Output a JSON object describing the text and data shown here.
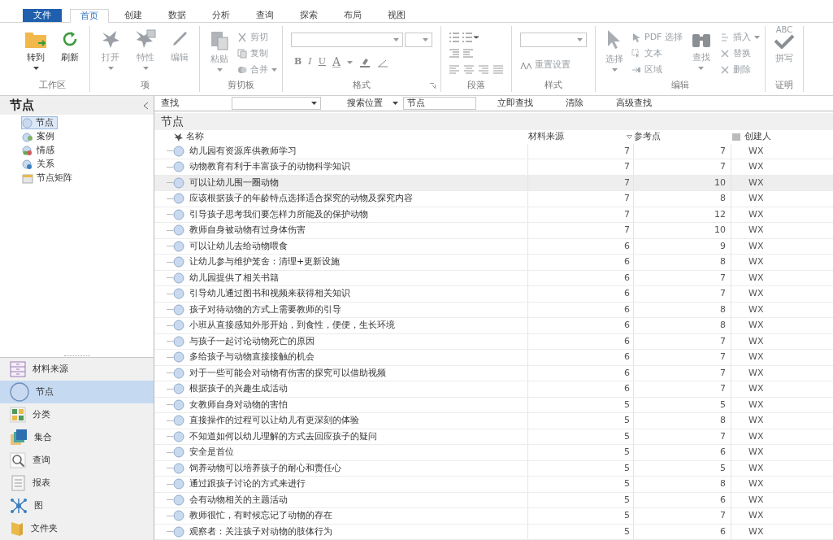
{
  "ribbon_tabs": [
    {
      "kind": "file",
      "label": "文件"
    },
    {
      "kind": "tab",
      "label": "首页",
      "selected": true
    },
    {
      "kind": "tab",
      "label": "创建",
      "selected": false
    },
    {
      "kind": "tab",
      "label": "数据",
      "selected": false
    },
    {
      "kind": "tab",
      "label": "分析",
      "selected": false
    },
    {
      "kind": "tab",
      "label": "查询",
      "selected": false
    },
    {
      "kind": "tab",
      "label": "探索",
      "selected": false
    },
    {
      "kind": "tab",
      "label": "布局",
      "selected": false
    },
    {
      "kind": "tab",
      "label": "视图",
      "selected": false
    }
  ],
  "ribbon_groups": [
    {
      "kind": "buttons",
      "label": "工作区",
      "items": [
        {
          "kind": "large",
          "label": "转到",
          "dropdown": true,
          "disabled": false
        },
        {
          "kind": "large",
          "label": "刷新",
          "dropdown": false,
          "disabled": false
        }
      ]
    },
    {
      "kind": "buttons",
      "label": "项",
      "items": [
        {
          "kind": "large",
          "label": "打开",
          "dropdown": true,
          "disabled": true
        },
        {
          "kind": "large",
          "label": "特性",
          "dropdown": true,
          "disabled": true
        },
        {
          "kind": "large",
          "label": "编辑",
          "dropdown": false,
          "disabled": true
        }
      ]
    },
    {
      "kind": "buttons",
      "label": "剪切板",
      "items": [
        {
          "kind": "large",
          "label": "粘贴",
          "dropdown": true,
          "disabled": true
        },
        {
          "kind": "small",
          "label": "剪切",
          "dropdown": false,
          "disabled": true
        },
        {
          "kind": "small",
          "label": "复制",
          "dropdown": false,
          "disabled": true
        },
        {
          "kind": "small",
          "label": "合并",
          "dropdown": true,
          "disabled": true
        }
      ]
    },
    {
      "kind": "format",
      "label": "格式",
      "launcher": true,
      "buttons": [
        {
          "label": "B"
        },
        {
          "label": "I"
        },
        {
          "label": "U"
        },
        {
          "label": "A"
        }
      ]
    },
    {
      "kind": "paragraph",
      "label": "段落"
    },
    {
      "kind": "style",
      "label": "样式",
      "items": [
        {
          "kind": "small",
          "label": "重置设置",
          "dropdown": false,
          "disabled": true
        }
      ]
    },
    {
      "kind": "buttons",
      "label": "编辑",
      "items": [
        {
          "kind": "large",
          "label": "选择",
          "dropdown": true,
          "disabled": true
        },
        {
          "kind": "small",
          "label": "PDF 选择",
          "dropdown": false,
          "disabled": true
        },
        {
          "kind": "small",
          "label": "文本",
          "dropdown": false,
          "disabled": true
        },
        {
          "kind": "small",
          "label": "区域",
          "dropdown": false,
          "disabled": true
        },
        {
          "kind": "large",
          "label": "查找",
          "dropdown": true,
          "disabled": true
        },
        {
          "kind": "small",
          "label": "插入",
          "dropdown": true,
          "disabled": true
        },
        {
          "kind": "small",
          "label": "替换",
          "dropdown": false,
          "disabled": true
        },
        {
          "kind": "small",
          "label": "删除",
          "dropdown": false,
          "disabled": true
        }
      ]
    },
    {
      "kind": "buttons",
      "label": "证明",
      "items": [
        {
          "kind": "spell",
          "label": "拼写",
          "icon_text": "ABC",
          "disabled": true
        }
      ]
    }
  ],
  "navigation": {
    "title": "节点",
    "tree": [
      {
        "label": "节点",
        "selected": true
      },
      {
        "label": "案例",
        "selected": false
      },
      {
        "label": "情感",
        "selected": false
      },
      {
        "label": "关系",
        "selected": false
      },
      {
        "label": "节点矩阵",
        "selected": false
      }
    ],
    "sections": [
      {
        "label": "材料来源",
        "selected": false
      },
      {
        "label": "节点",
        "selected": true
      },
      {
        "label": "分类",
        "selected": false
      },
      {
        "label": "集合",
        "selected": false
      },
      {
        "label": "查询",
        "selected": false
      },
      {
        "label": "报表",
        "selected": false
      },
      {
        "label": "图",
        "selected": false
      },
      {
        "label": "文件夹",
        "selected": false
      }
    ]
  },
  "find_bar": {
    "label": "查找",
    "scope_label": "搜索位置",
    "scope_value": "节点",
    "buttons": [
      "立即查找",
      "清除",
      "高级查找"
    ]
  },
  "list_view": {
    "title": "节点",
    "columns": [
      {
        "label": "名称",
        "sorted": false
      },
      {
        "label": "材料来源",
        "sorted": true
      },
      {
        "label": "参考点",
        "sorted": false
      },
      {
        "label": "创建人",
        "sorted": false
      }
    ],
    "rows": [
      {
        "name": "幼儿园有资源库供教师学习",
        "sources": "7",
        "references": "7",
        "creator": "WX",
        "selected": false
      },
      {
        "name": "动物教育有利于丰富孩子的动物科学知识",
        "sources": "7",
        "references": "7",
        "creator": "WX",
        "selected": false
      },
      {
        "name": "可以让幼儿围一圈动物",
        "sources": "7",
        "references": "10",
        "creator": "WX",
        "selected": true
      },
      {
        "name": "应该根据孩子的年龄特点选择适合探究的动物及探究内容",
        "sources": "7",
        "references": "8",
        "creator": "WX",
        "selected": false
      },
      {
        "name": "引导孩子思考我们要怎样力所能及的保护动物",
        "sources": "7",
        "references": "12",
        "creator": "WX",
        "selected": false
      },
      {
        "name": "教师自身被动物有过身体伤害",
        "sources": "7",
        "references": "10",
        "creator": "WX",
        "selected": false
      },
      {
        "name": "可以让幼儿去给动物喂食",
        "sources": "6",
        "references": "9",
        "creator": "WX",
        "selected": false
      },
      {
        "name": "让幼儿参与维护笼舍：清理+更新设施",
        "sources": "6",
        "references": "8",
        "creator": "WX",
        "selected": false
      },
      {
        "name": "幼儿园提供了相关书籍",
        "sources": "6",
        "references": "7",
        "creator": "WX",
        "selected": false
      },
      {
        "name": "引导幼儿通过图书和视频来获得相关知识",
        "sources": "6",
        "references": "7",
        "creator": "WX",
        "selected": false
      },
      {
        "name": "孩子对待动物的方式上需要教师的引导",
        "sources": "6",
        "references": "8",
        "creator": "WX",
        "selected": false
      },
      {
        "name": "小班从直接感知外形开始，到食性，便便，生长环境",
        "sources": "6",
        "references": "8",
        "creator": "WX",
        "selected": false
      },
      {
        "name": "与孩子一起讨论动物死亡的原因",
        "sources": "6",
        "references": "7",
        "creator": "WX",
        "selected": false
      },
      {
        "name": "多给孩子与动物直接接触的机会",
        "sources": "6",
        "references": "7",
        "creator": "WX",
        "selected": false
      },
      {
        "name": "对于一些可能会对动物有伤害的探究可以借助视频",
        "sources": "6",
        "references": "7",
        "creator": "WX",
        "selected": false
      },
      {
        "name": "根据孩子的兴趣生成活动",
        "sources": "6",
        "references": "7",
        "creator": "WX",
        "selected": false
      },
      {
        "name": "女教师自身对动物的害怕",
        "sources": "5",
        "references": "5",
        "creator": "WX",
        "selected": false
      },
      {
        "name": "直接操作的过程可以让幼儿有更深刻的体验",
        "sources": "5",
        "references": "8",
        "creator": "WX",
        "selected": false
      },
      {
        "name": "不知道如何以幼儿理解的方式去回应孩子的疑问",
        "sources": "5",
        "references": "7",
        "creator": "WX",
        "selected": false
      },
      {
        "name": "安全是首位",
        "sources": "5",
        "references": "6",
        "creator": "WX",
        "selected": false
      },
      {
        "name": "饲养动物可以培养孩子的耐心和责任心",
        "sources": "5",
        "references": "5",
        "creator": "WX",
        "selected": false
      },
      {
        "name": "通过跟孩子讨论的方式来进行",
        "sources": "5",
        "references": "8",
        "creator": "WX",
        "selected": false
      },
      {
        "name": "会有动物相关的主题活动",
        "sources": "5",
        "references": "6",
        "creator": "WX",
        "selected": false
      },
      {
        "name": "教师很忙，有时候忘记了动物的存在",
        "sources": "5",
        "references": "7",
        "creator": "WX",
        "selected": false
      },
      {
        "name": "观察者：关注孩子对动物的肢体行为",
        "sources": "5",
        "references": "6",
        "creator": "WX",
        "selected": false
      }
    ]
  }
}
